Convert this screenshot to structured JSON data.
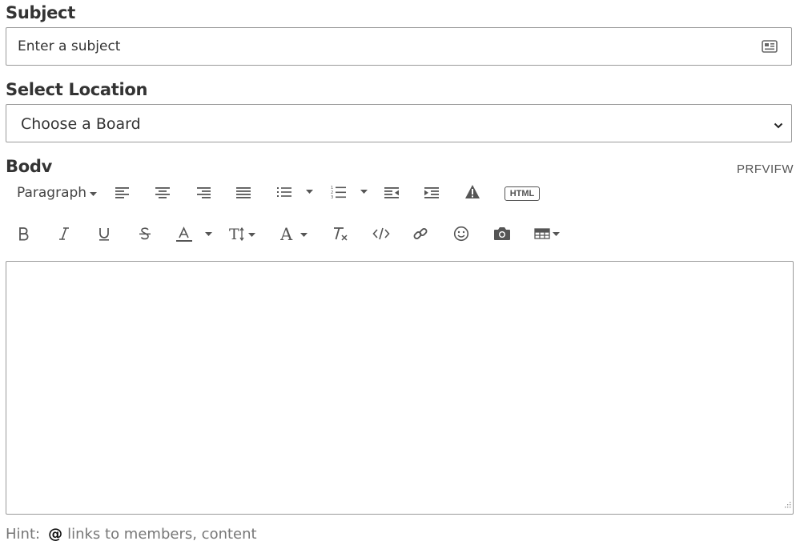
{
  "subject": {
    "label": "Subject",
    "placeholder": "Enter a subject",
    "icon": "contact-card-icon"
  },
  "location": {
    "label": "Select Location",
    "selected": "Choose a Board"
  },
  "body": {
    "label": "Bodv",
    "preview_label": "PRFVIFW",
    "value": ""
  },
  "toolbar": {
    "paragraph_label": "Paragraph",
    "html_label": "HTML",
    "row1_icons": [
      "align-left-icon",
      "align-center-icon",
      "align-right-icon",
      "align-justify-icon",
      "bulleted-list-icon",
      "numbered-list-icon",
      "outdent-icon",
      "indent-icon",
      "warning-icon",
      "html-icon"
    ],
    "row2_icons": [
      "bold-icon",
      "italic-icon",
      "underline-icon",
      "strikethrough-icon",
      "font-color-icon",
      "text-size-icon",
      "font-family-icon",
      "clear-format-icon",
      "code-icon",
      "link-icon",
      "emoji-icon",
      "camera-icon",
      "table-icon"
    ]
  },
  "hint": {
    "prefix": "Hint:",
    "symbol": "@",
    "text": "links to members, content"
  },
  "colors": {
    "border": "#9a9a9a",
    "text": "#333333",
    "icon": "#555555",
    "hint": "#777777"
  }
}
